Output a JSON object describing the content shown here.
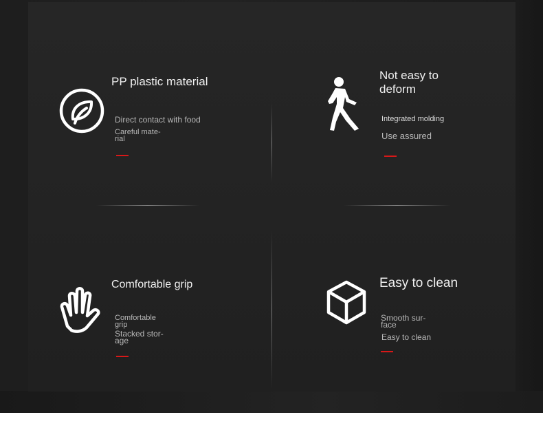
{
  "features": [
    {
      "title": "PP plastic material",
      "line1": "Direct contact with food",
      "line2": "Careful mate-\nrial",
      "icon": "leaf-icon"
    },
    {
      "title": "Not easy to\ndeform",
      "line1": "Integrated molding",
      "line2": "Use assured",
      "icon": "walking-person-icon"
    },
    {
      "title": "Comfortable grip",
      "line1": "Comfortable\ngrip",
      "line2": "Stacked stor-\nage",
      "icon": "hand-icon"
    },
    {
      "title": "Easy to clean",
      "line1": "Smooth sur-\nface",
      "line2": "Easy to clean",
      "icon": "cube-icon"
    }
  ],
  "colors": {
    "background": "#232323",
    "text": "#f0f0f0",
    "subtext": "#b8b8b8",
    "accent": "#d81818"
  }
}
